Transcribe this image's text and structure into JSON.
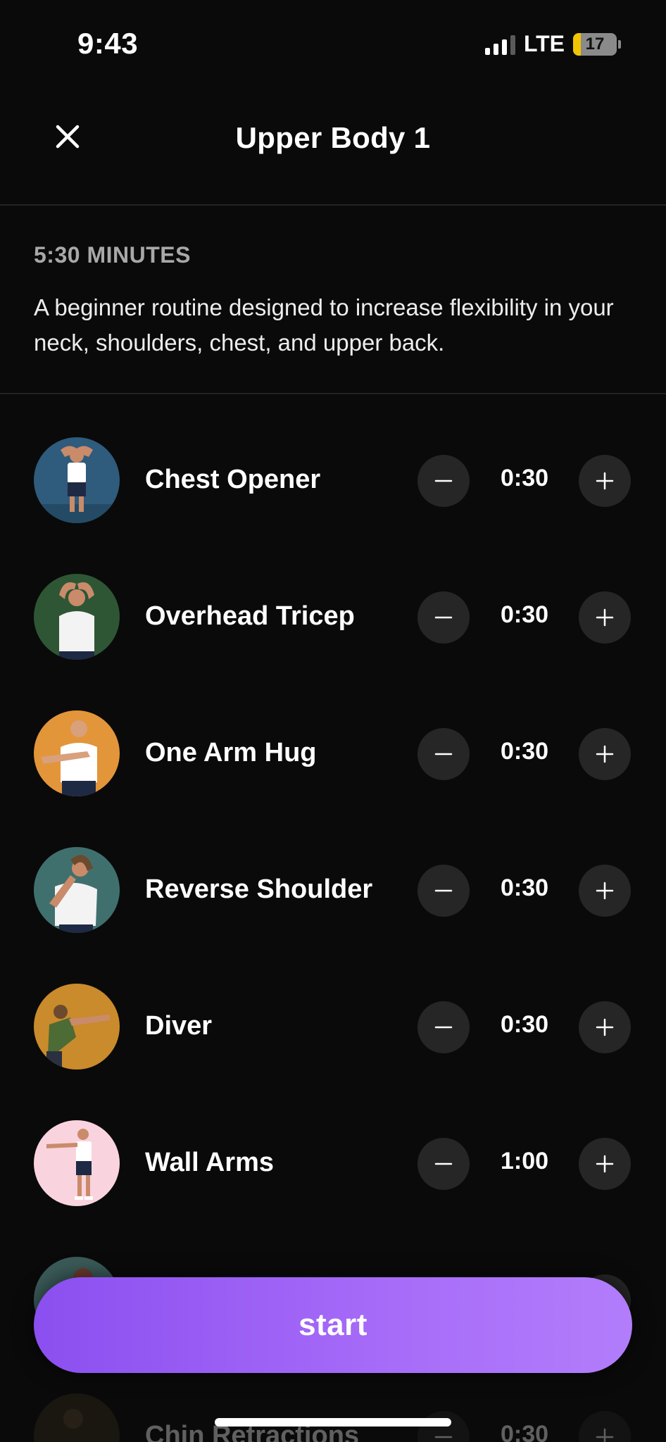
{
  "status_bar": {
    "time": "9:43",
    "network": "LTE",
    "battery_level": "17",
    "battery_fraction": 0.17
  },
  "header": {
    "title": "Upper Body 1",
    "close_icon": "close-icon"
  },
  "intro": {
    "duration": "5:30 MINUTES",
    "description": "A beginner routine designed to increase flexibility in your neck, shoulders, chest, and upper back."
  },
  "exercises": [
    {
      "name": "Chest Opener",
      "duration": "0:30",
      "avatar_bg": "#2f5b7c"
    },
    {
      "name": "Overhead Tricep",
      "duration": "0:30",
      "avatar_bg": "#2e5634"
    },
    {
      "name": "One Arm Hug",
      "duration": "0:30",
      "avatar_bg": "#e3953a"
    },
    {
      "name": "Reverse Shoulder",
      "duration": "0:30",
      "avatar_bg": "#40706e"
    },
    {
      "name": "Diver",
      "duration": "0:30",
      "avatar_bg": "#c98b2b"
    },
    {
      "name": "Wall Arms",
      "duration": "1:00",
      "avatar_bg": "#f9d4de"
    },
    {
      "name": "",
      "duration": "",
      "avatar_bg": "#3a5a58"
    },
    {
      "name": "Chin Retractions",
      "duration": "0:30",
      "avatar_bg": "#3a3020"
    }
  ],
  "start_button": {
    "label": "start"
  },
  "colors": {
    "background": "#0a0a0a",
    "accent": "#9b5cf6",
    "stepper_bg": "#262626",
    "divider": "#232323"
  }
}
